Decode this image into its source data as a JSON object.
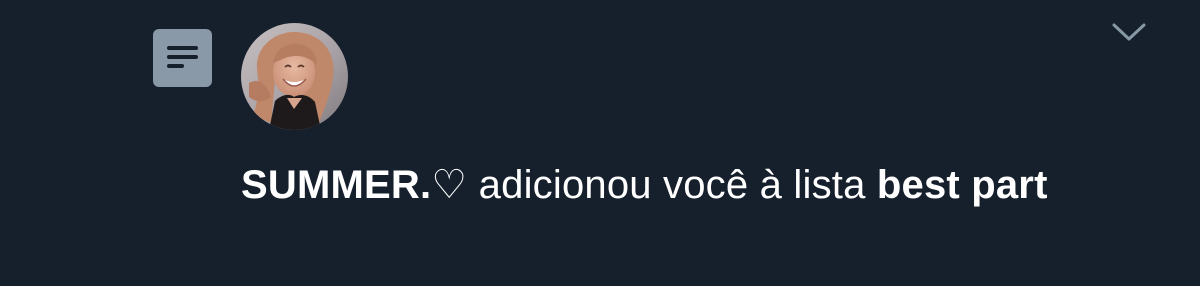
{
  "notification": {
    "type_icon": "list-icon",
    "avatar_icon": "user-avatar-photo",
    "menu_icon": "chevron-down-icon",
    "user_name": "SUMMER.♡",
    "action_text": " adicionou você à lista ",
    "list_name": "best part"
  },
  "colors": {
    "background": "#16202c",
    "icon_box": "#8a99a8",
    "text": "#ffffff",
    "chevron": "#8899a6"
  }
}
